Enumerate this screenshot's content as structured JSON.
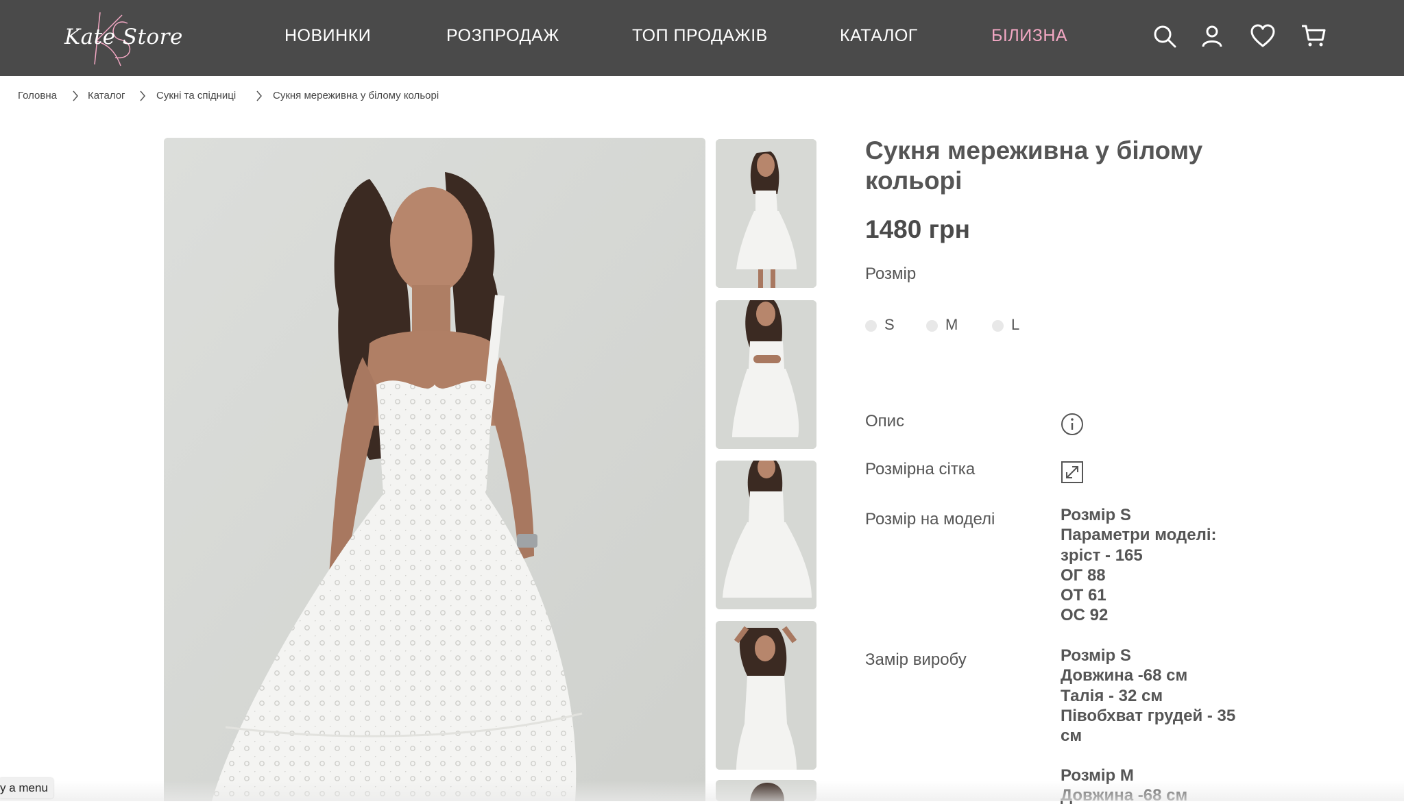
{
  "header": {
    "logo_text": "Kate Store",
    "nav": [
      "НОВИНКИ",
      "РОЗПРОДАЖ",
      "ТОП ПРОДАЖІВ",
      "КАТАЛОГ",
      "БІЛИЗНА"
    ],
    "nav_highlight_color": "#f2a7c3",
    "icons": [
      "search-icon",
      "user-icon",
      "heart-icon",
      "cart-icon"
    ]
  },
  "breadcrumb": [
    "Головна",
    "Каталог",
    "Сукні та спідниці",
    "Сукня мереживна у білому кольорі"
  ],
  "product": {
    "title": "Сукня мереживна у білому кольорі",
    "price": "1480 грн",
    "size_label": "Розмір",
    "sizes": [
      "S",
      "M",
      "L"
    ],
    "description_label": "Опис",
    "size_chart_label": "Розмірна сітка",
    "model_size_label": "Розмір на моделі",
    "model_size_lines": [
      "Розмір S",
      "Параметри моделі:",
      "зріст - 165",
      "ОГ 88",
      "ОТ 61",
      "ОС 92"
    ],
    "measure_label": "Замір виробу",
    "measure_lines": [
      "Розмір S",
      "Довжина -68 см",
      "Талія - 32 см",
      "Півобхват грудей - 35",
      "см"
    ],
    "measure_lines_2": [
      "Розмір M",
      "Довжина -68 см"
    ]
  },
  "menu_tip": "y a menu"
}
